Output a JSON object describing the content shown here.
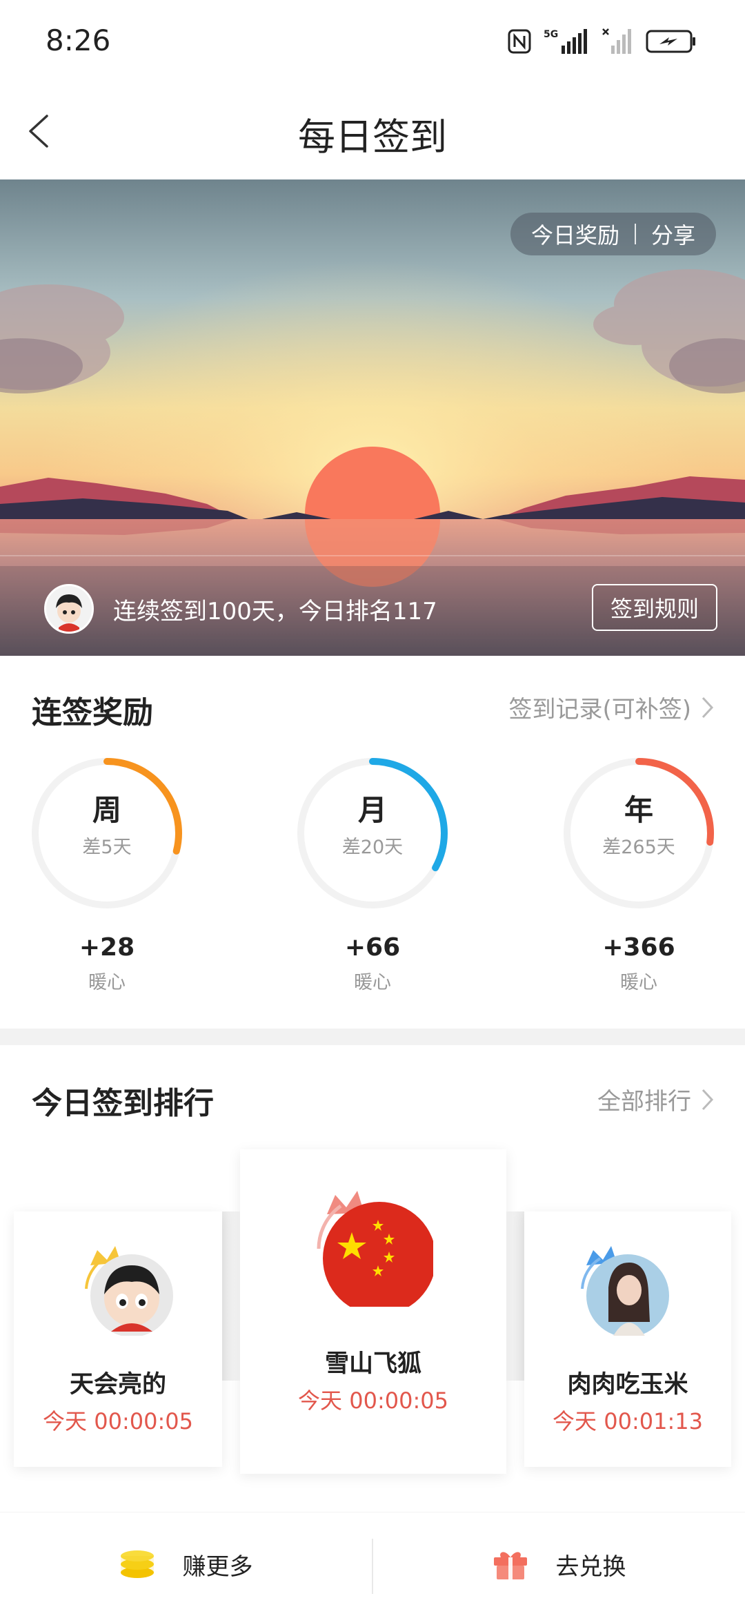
{
  "status": {
    "time": "8:26",
    "network": "5G",
    "icons": [
      "nfc-icon",
      "signal-icon",
      "no-signal-icon",
      "battery-icon"
    ]
  },
  "header": {
    "title": "每日签到",
    "back_icon": "chevron-left-icon"
  },
  "banner": {
    "today_reward": "今日奖励",
    "share": "分享",
    "streak_text": "连续签到100天，今日排名117",
    "rules_button": "签到规则"
  },
  "rewards": {
    "title": "连签奖励",
    "records_link": "签到记录(可补签)",
    "items": [
      {
        "period": "周",
        "remaining": "差5天",
        "points": "+28",
        "unit": "暖心",
        "color": "#f7931e",
        "progress": 0.29
      },
      {
        "period": "月",
        "remaining": "差20天",
        "points": "+66",
        "unit": "暖心",
        "color": "#1fa8e6",
        "progress": 0.33
      },
      {
        "period": "年",
        "remaining": "差265天",
        "points": "+366",
        "unit": "暖心",
        "color": "#f26349",
        "progress": 0.27
      }
    ]
  },
  "ranking": {
    "title": "今日签到排行",
    "all_link": "全部排行",
    "entries": [
      {
        "rank": 2,
        "name": "天会亮的",
        "time": "今天 00:00:05",
        "crown_color": "#f6c53a"
      },
      {
        "rank": 1,
        "name": "雪山飞狐",
        "time": "今天 00:00:05",
        "crown_color": "#f08a80"
      },
      {
        "rank": 3,
        "name": "肉肉吃玉米",
        "time": "今天 00:01:13",
        "crown_color": "#4a9be8"
      }
    ]
  },
  "bottom": {
    "earn_more": "赚更多",
    "redeem": "去兑换"
  }
}
